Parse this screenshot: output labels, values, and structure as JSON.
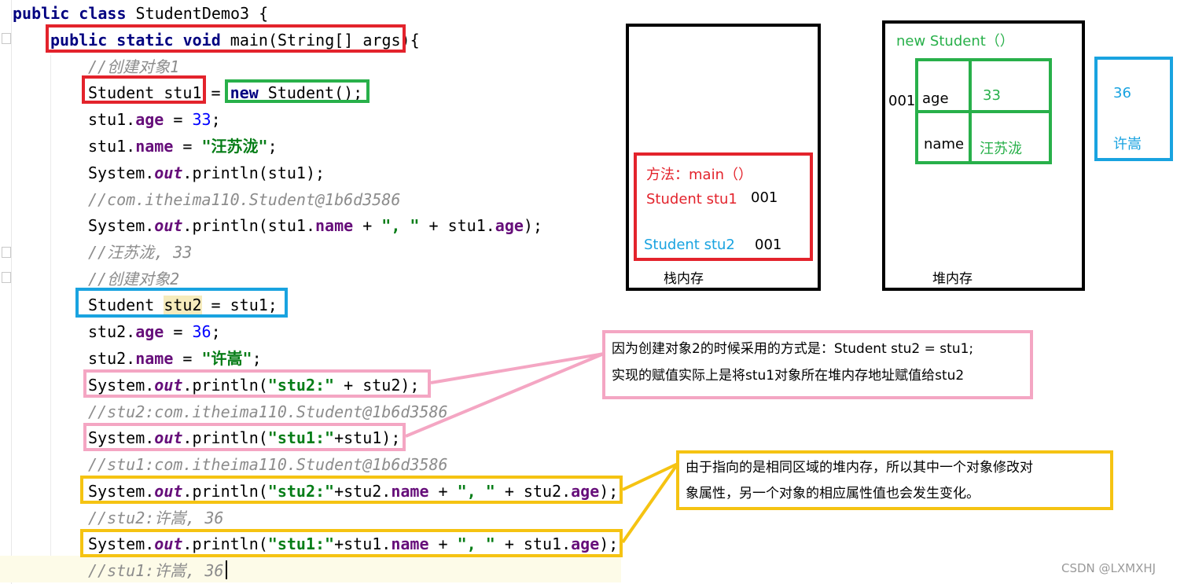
{
  "code": {
    "l1_kw": "public class",
    "l1_rest": " StudentDemo3 {",
    "l2_kw": "public static void",
    "l2_rest": " main(String[] args)",
    "l2_brace": "{",
    "l3": "//创建对象1",
    "l4_a": "Student stu1",
    "l4_b": " = ",
    "l4_new": "new",
    "l4_c": " Student();",
    "l5_a": "stu1.",
    "l5_f": "age",
    "l5_b": " = ",
    "l5_n": "33",
    "l5_c": ";",
    "l6_a": "stu1.",
    "l6_f": "name",
    "l6_b": " = ",
    "l6_s": "\"汪苏泷\"",
    "l6_c": ";",
    "l7_a": "System.",
    "l7_m": "out",
    "l7_b": ".println(stu1);",
    "l8": "//com.itheima110.Student@1b6d3586",
    "l9_a": "System.",
    "l9_m": "out",
    "l9_b": ".println(stu1.",
    "l9_f1": "name",
    "l9_c": " + ",
    "l9_s": "\", \"",
    "l9_d": " + stu1.",
    "l9_f2": "age",
    "l9_e": ");",
    "l10": "//汪苏泷, 33",
    "l11": "//创建对象2",
    "l12_a": "Student ",
    "l12_h": "stu2",
    "l12_b": " = stu1;",
    "l13_a": "stu2.",
    "l13_f": "age",
    "l13_b": " = ",
    "l13_n": "36",
    "l13_c": ";",
    "l14_a": "stu2.",
    "l14_f": "name",
    "l14_b": " = ",
    "l14_s": "\"许嵩\"",
    "l14_c": ";",
    "l15_a": "System.",
    "l15_m": "out",
    "l15_b": ".println(",
    "l15_s": "\"stu2:\"",
    "l15_c": " + stu2);",
    "l16": "//stu2:com.itheima110.Student@1b6d3586",
    "l17_a": "System.",
    "l17_m": "out",
    "l17_b": ".println(",
    "l17_s": "\"stu1:\"",
    "l17_c": "+stu1);",
    "l18": "//stu1:com.itheima110.Student@1b6d3586",
    "l19_a": "System.",
    "l19_m": "out",
    "l19_b": ".println(",
    "l19_s": "\"stu2:\"",
    "l19_c": "+stu2.",
    "l19_f1": "name",
    "l19_d": " + ",
    "l19_s2": "\", \"",
    "l19_e": " + stu2.",
    "l19_f2": "age",
    "l19_g": ");",
    "l20": "//stu2:许嵩, 36",
    "l21_a": "System.",
    "l21_m": "out",
    "l21_b": ".println(",
    "l21_s": "\"stu1:\"",
    "l21_c": "+stu1.",
    "l21_f1": "name",
    "l21_d": " + ",
    "l21_s2": "\", \"",
    "l21_e": " + stu1.",
    "l21_f2": "age",
    "l21_g": ");",
    "l22": "//stu1:许嵩, 36"
  },
  "stack": {
    "label": "栈内存",
    "method": "方法：main（）",
    "var1": "Student stu1",
    "var1_addr": "001",
    "var2": "Student stu2",
    "var2_addr": "001"
  },
  "heap": {
    "label": "堆内存",
    "title": "new Student（）",
    "addr": "001",
    "age_key": "age",
    "age_val": "33",
    "name_key": "name",
    "name_val": "汪苏泷"
  },
  "new_values": {
    "age": "36",
    "name": "许嵩"
  },
  "note1": {
    "line1": "因为创建对象2的时候采用的方式是：Student stu2 = stu1;",
    "line2": "实现的赋值实际上是将stu1对象所在堆内存地址赋值给stu2"
  },
  "note2": {
    "line1": "由于指向的是相同区域的堆内存，所以其中一个对象修改对",
    "line2": "象属性，另一个对象的相应属性值也会发生变化。"
  },
  "watermark": "CSDN @LXMXHJ",
  "colors": {
    "red": "#e3232c",
    "green": "#28b04a",
    "blue": "#19a3e0",
    "pink": "#f4a6c3",
    "yellow": "#f5c312"
  }
}
